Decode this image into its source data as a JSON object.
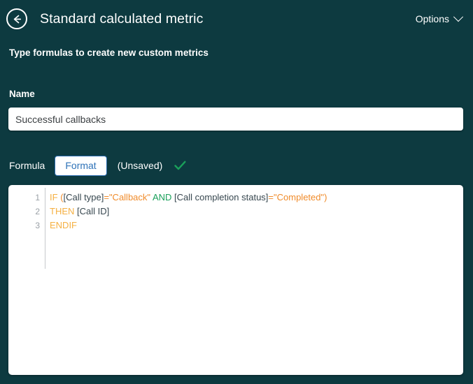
{
  "header": {
    "back_icon": "back-arrow-circle-icon",
    "title": "Standard calculated metric",
    "options_label": "Options",
    "chevron_icon": "chevron-down-icon"
  },
  "subtitle": "Type formulas to create new custom metrics",
  "name_section": {
    "label": "Name",
    "value": "Successful callbacks",
    "placeholder": "Name"
  },
  "tabs": {
    "formula_label": "Formula",
    "format_label": "Format",
    "unsaved_label": "(Unsaved)",
    "valid_icon": "green-checkmark-icon"
  },
  "formula": {
    "lines": [
      {
        "number": "1",
        "tokens": [
          {
            "text": "IF",
            "type": "kw"
          },
          {
            "text": " ",
            "type": "plain"
          },
          {
            "text": "(",
            "type": "op"
          },
          {
            "text": "[Call type]",
            "type": "fld"
          },
          {
            "text": "=",
            "type": "op"
          },
          {
            "text": "\"Callback\"",
            "type": "str"
          },
          {
            "text": " ",
            "type": "plain"
          },
          {
            "text": "AND",
            "type": "and"
          },
          {
            "text": " ",
            "type": "plain"
          },
          {
            "text": "[Call completion status]",
            "type": "fld"
          },
          {
            "text": "=",
            "type": "op"
          },
          {
            "text": "\"Completed\"",
            "type": "str"
          },
          {
            "text": ")",
            "type": "op"
          }
        ]
      },
      {
        "number": "2",
        "tokens": [
          {
            "text": "THEN",
            "type": "kw"
          },
          {
            "text": " ",
            "type": "plain"
          },
          {
            "text": "[Call ID]",
            "type": "fld"
          }
        ]
      },
      {
        "number": "3",
        "tokens": [
          {
            "text": "ENDIF",
            "type": "kw"
          }
        ]
      }
    ]
  },
  "colors": {
    "background": "#0d3a40",
    "keyword": "#f5b042",
    "operator": "#f08b2a",
    "string": "#f08b2a",
    "logical": "#1aa05a",
    "field": "#37474f",
    "accent_blue": "#2f73b8",
    "check_green": "#1aa05a"
  }
}
